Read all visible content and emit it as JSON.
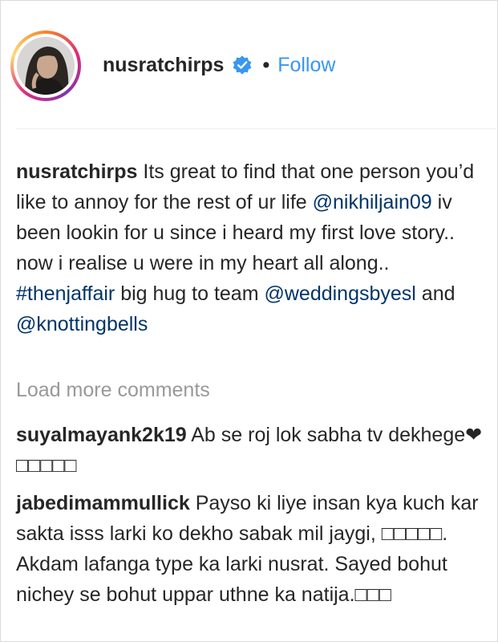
{
  "post_header": {
    "username": "nusratchirps",
    "separator": "•",
    "follow_label": "Follow",
    "verified": true,
    "ring_colors": [
      "#f58529",
      "#dd2a7b",
      "#8134af",
      "#feda77"
    ],
    "follow_color": "#3897f0"
  },
  "caption": {
    "username": "nusratchirps",
    "text_1": " Its great to find that one person you’d like to annoy for the rest of ur life ",
    "mention_1": "@nikhiljain09",
    "text_2": " iv been lookin for u since i heard my first love story.. now i realise u were in my heart all along.. ",
    "hashtag": "#thenjaffair",
    "text_3": " big hug to team ",
    "mention_2": "@weddingsbyesl",
    "text_4": " and ",
    "mention_3": "@knottingbells"
  },
  "load_more": {
    "label": "Load more comments"
  },
  "comments": [
    {
      "username": "suyalmayank2k19",
      "text": " Ab se roj lok sabha tv dekhege❤□□□□□"
    },
    {
      "username": "jabedimammullick",
      "text": " Payso ki liye insan kya kuch kar sakta isss larki ko dekho sabak mil jaygi, □□□□□. Akdam lafanga type ka larki nusrat. Sayed bohut nichey se bohut uppar uthne ka natija.□□□"
    }
  ]
}
